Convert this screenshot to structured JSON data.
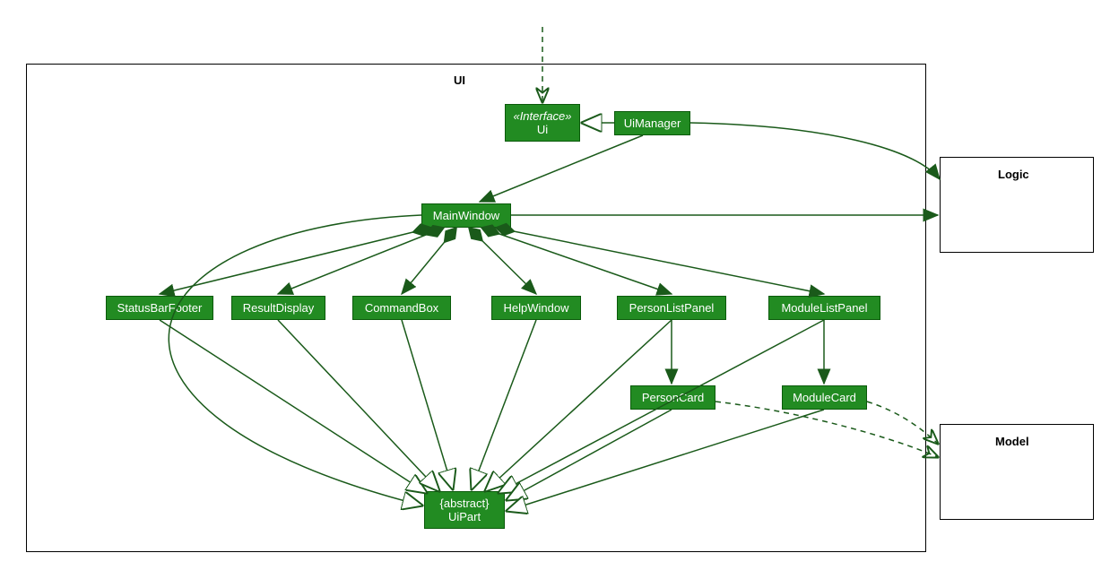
{
  "packages": {
    "ui": {
      "label": "UI"
    },
    "logic": {
      "label": "Logic"
    },
    "model": {
      "label": "Model"
    }
  },
  "classes": {
    "ui_interface": {
      "stereotype": "«Interface»",
      "name": "Ui"
    },
    "ui_manager": {
      "name": "UiManager"
    },
    "main_window": {
      "name": "MainWindow"
    },
    "status_bar_footer": {
      "name": "StatusBarFooter"
    },
    "result_display": {
      "name": "ResultDisplay"
    },
    "command_box": {
      "name": "CommandBox"
    },
    "help_window": {
      "name": "HelpWindow"
    },
    "person_list_panel": {
      "name": "PersonListPanel"
    },
    "module_list_panel": {
      "name": "ModuleListPanel"
    },
    "person_card": {
      "name": "PersonCard"
    },
    "module_card": {
      "name": "ModuleCard"
    },
    "ui_part": {
      "stereotype": "{abstract}",
      "name": "UiPart"
    }
  },
  "relationships": [
    {
      "type": "dependency",
      "from": "external-top",
      "to": "Ui"
    },
    {
      "type": "realization",
      "from": "UiManager",
      "to": "Ui"
    },
    {
      "type": "association",
      "from": "UiManager",
      "to": "MainWindow"
    },
    {
      "type": "association",
      "from": "UiManager",
      "to": "Logic"
    },
    {
      "type": "association",
      "from": "MainWindow",
      "to": "Logic"
    },
    {
      "type": "composition",
      "from": "MainWindow",
      "to": "StatusBarFooter"
    },
    {
      "type": "composition",
      "from": "MainWindow",
      "to": "ResultDisplay"
    },
    {
      "type": "composition",
      "from": "MainWindow",
      "to": "CommandBox"
    },
    {
      "type": "composition",
      "from": "MainWindow",
      "to": "HelpWindow"
    },
    {
      "type": "composition",
      "from": "MainWindow",
      "to": "PersonListPanel"
    },
    {
      "type": "composition",
      "from": "MainWindow",
      "to": "ModuleListPanel"
    },
    {
      "type": "association",
      "from": "PersonListPanel",
      "to": "PersonCard"
    },
    {
      "type": "association",
      "from": "ModuleListPanel",
      "to": "ModuleCard"
    },
    {
      "type": "dependency",
      "from": "PersonCard",
      "to": "Model"
    },
    {
      "type": "dependency",
      "from": "ModuleCard",
      "to": "Model"
    },
    {
      "type": "generalization",
      "from": "MainWindow",
      "to": "UiPart"
    },
    {
      "type": "generalization",
      "from": "StatusBarFooter",
      "to": "UiPart"
    },
    {
      "type": "generalization",
      "from": "ResultDisplay",
      "to": "UiPart"
    },
    {
      "type": "generalization",
      "from": "CommandBox",
      "to": "UiPart"
    },
    {
      "type": "generalization",
      "from": "HelpWindow",
      "to": "UiPart"
    },
    {
      "type": "generalization",
      "from": "PersonListPanel",
      "to": "UiPart"
    },
    {
      "type": "generalization",
      "from": "ModuleListPanel",
      "to": "UiPart"
    },
    {
      "type": "generalization",
      "from": "PersonCard",
      "to": "UiPart"
    },
    {
      "type": "generalization",
      "from": "ModuleCard",
      "to": "UiPart"
    }
  ]
}
